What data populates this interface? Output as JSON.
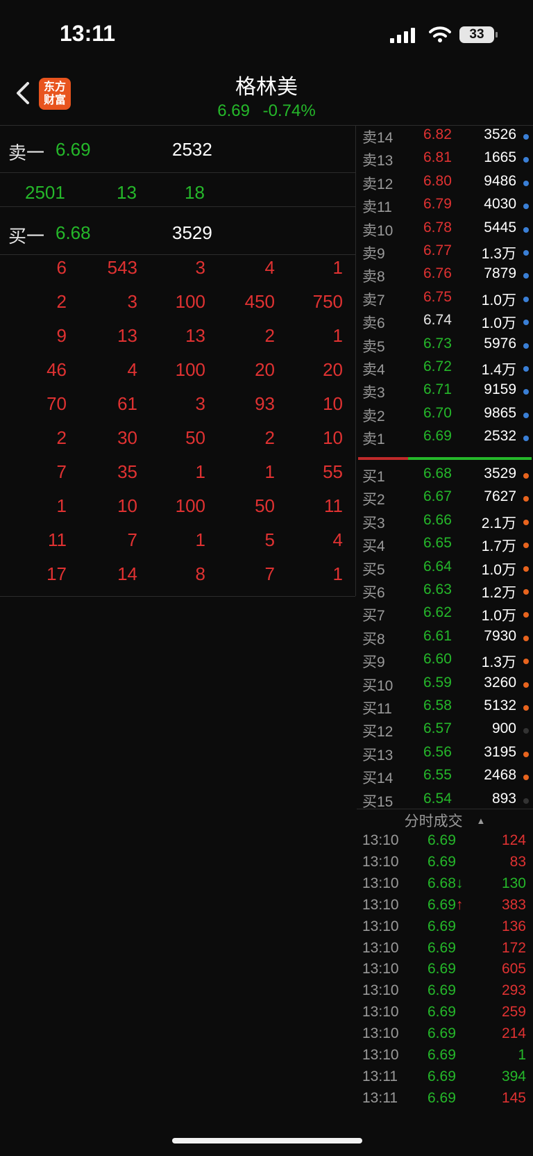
{
  "status_bar": {
    "time": "13:11",
    "battery": "33"
  },
  "header": {
    "logo_line1": "东方",
    "logo_line2": "财富",
    "stock_name": "格林美",
    "price": "6.69",
    "change_pct": "-0.74%"
  },
  "best_quote": {
    "ask_label": "卖一",
    "ask_price": "6.69",
    "ask_volume": "2532",
    "stats": [
      "2501",
      "13",
      "18"
    ],
    "bid_label": "买一",
    "bid_price": "6.68",
    "bid_volume": "3529"
  },
  "queue_grid": [
    [
      "6",
      "543",
      "3",
      "4",
      "1"
    ],
    [
      "2",
      "3",
      "100",
      "450",
      "750"
    ],
    [
      "9",
      "13",
      "13",
      "2",
      "1"
    ],
    [
      "46",
      "4",
      "100",
      "20",
      "20"
    ],
    [
      "70",
      "61",
      "3",
      "93",
      "10"
    ],
    [
      "2",
      "30",
      "50",
      "2",
      "10"
    ],
    [
      "7",
      "35",
      "1",
      "1",
      "55"
    ],
    [
      "1",
      "10",
      "100",
      "50",
      "11"
    ],
    [
      "11",
      "7",
      "1",
      "5",
      "4"
    ],
    [
      "17",
      "14",
      "8",
      "7",
      "1"
    ]
  ],
  "asks": [
    {
      "label": "卖14",
      "price": "6.82",
      "volume": "3526",
      "color": "red"
    },
    {
      "label": "卖13",
      "price": "6.81",
      "volume": "1665",
      "color": "red"
    },
    {
      "label": "卖12",
      "price": "6.80",
      "volume": "9486",
      "color": "red"
    },
    {
      "label": "卖11",
      "price": "6.79",
      "volume": "4030",
      "color": "red"
    },
    {
      "label": "卖10",
      "price": "6.78",
      "volume": "5445",
      "color": "red"
    },
    {
      "label": "卖9",
      "price": "6.77",
      "volume": "1.3万",
      "color": "red"
    },
    {
      "label": "卖8",
      "price": "6.76",
      "volume": "7879",
      "color": "red"
    },
    {
      "label": "卖7",
      "price": "6.75",
      "volume": "1.0万",
      "color": "red"
    },
    {
      "label": "卖6",
      "price": "6.74",
      "volume": "1.0万",
      "color": "white"
    },
    {
      "label": "卖5",
      "price": "6.73",
      "volume": "5976",
      "color": "green"
    },
    {
      "label": "卖4",
      "price": "6.72",
      "volume": "1.4万",
      "color": "green"
    },
    {
      "label": "卖3",
      "price": "6.71",
      "volume": "9159",
      "color": "green"
    },
    {
      "label": "卖2",
      "price": "6.70",
      "volume": "9865",
      "color": "green"
    },
    {
      "label": "卖1",
      "price": "6.69",
      "volume": "2532",
      "color": "green"
    }
  ],
  "bids": [
    {
      "label": "买1",
      "price": "6.68",
      "volume": "3529",
      "dot": "#e8641e"
    },
    {
      "label": "买2",
      "price": "6.67",
      "volume": "7627",
      "dot": "#e8641e"
    },
    {
      "label": "买3",
      "price": "6.66",
      "volume": "2.1万",
      "dot": "#e8641e"
    },
    {
      "label": "买4",
      "price": "6.65",
      "volume": "1.7万",
      "dot": "#e8641e"
    },
    {
      "label": "买5",
      "price": "6.64",
      "volume": "1.0万",
      "dot": "#e8641e"
    },
    {
      "label": "买6",
      "price": "6.63",
      "volume": "1.2万",
      "dot": "#e8641e"
    },
    {
      "label": "买7",
      "price": "6.62",
      "volume": "1.0万",
      "dot": "#e8641e"
    },
    {
      "label": "买8",
      "price": "6.61",
      "volume": "7930",
      "dot": "#e8641e"
    },
    {
      "label": "买9",
      "price": "6.60",
      "volume": "1.3万",
      "dot": "#e8641e"
    },
    {
      "label": "买10",
      "price": "6.59",
      "volume": "3260",
      "dot": "#e8641e"
    },
    {
      "label": "买11",
      "price": "6.58",
      "volume": "5132",
      "dot": "#e8641e"
    },
    {
      "label": "买12",
      "price": "6.57",
      "volume": "900",
      "dot": "#333333"
    },
    {
      "label": "买13",
      "price": "6.56",
      "volume": "3195",
      "dot": "#e8641e"
    },
    {
      "label": "买14",
      "price": "6.55",
      "volume": "2468",
      "dot": "#e8641e"
    },
    {
      "label": "买15",
      "price": "6.54",
      "volume": "893",
      "dot": "#333333"
    }
  ],
  "trades_title": "分时成交",
  "trades": [
    {
      "time": "13:10",
      "price": "6.69",
      "volume": "124",
      "vol_color": "red"
    },
    {
      "time": "13:10",
      "price": "6.69",
      "volume": "83",
      "vol_color": "red"
    },
    {
      "time": "13:10",
      "price": "6.68↓",
      "volume": "130",
      "vol_color": "green"
    },
    {
      "time": "13:10",
      "price": "6.69↑",
      "volume": "383",
      "vol_color": "red"
    },
    {
      "time": "13:10",
      "price": "6.69",
      "volume": "136",
      "vol_color": "red"
    },
    {
      "time": "13:10",
      "price": "6.69",
      "volume": "172",
      "vol_color": "red"
    },
    {
      "time": "13:10",
      "price": "6.69",
      "volume": "605",
      "vol_color": "red"
    },
    {
      "time": "13:10",
      "price": "6.69",
      "volume": "293",
      "vol_color": "red"
    },
    {
      "time": "13:10",
      "price": "6.69",
      "volume": "259",
      "vol_color": "red"
    },
    {
      "time": "13:10",
      "price": "6.69",
      "volume": "214",
      "vol_color": "red"
    },
    {
      "time": "13:10",
      "price": "6.69",
      "volume": "1",
      "vol_color": "green"
    },
    {
      "time": "13:11",
      "price": "6.69",
      "volume": "394",
      "vol_color": "green"
    },
    {
      "time": "13:11",
      "price": "6.69",
      "volume": "145",
      "vol_color": "red"
    }
  ],
  "colors": {
    "up": "#e03232",
    "down": "#25b82a",
    "ask_dot": "#3a7fd6",
    "bid_dot": "#e8641e"
  }
}
